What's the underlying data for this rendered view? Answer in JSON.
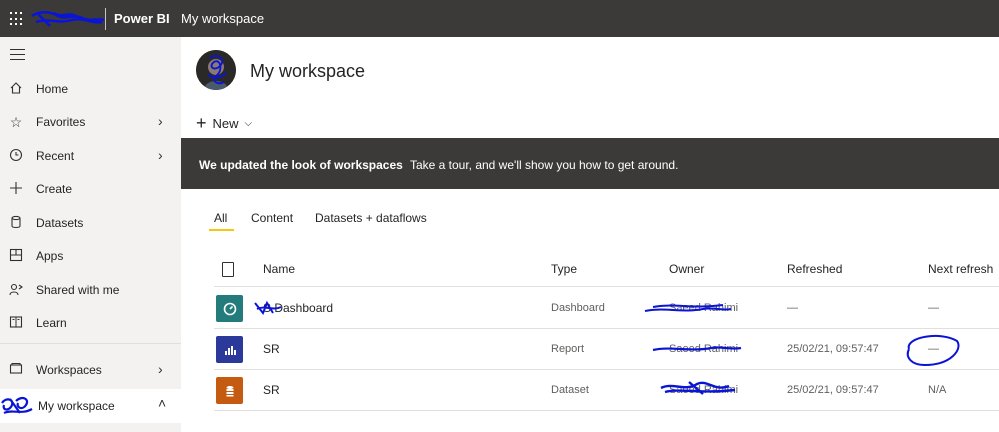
{
  "topbar": {
    "app_name": "Power BI",
    "breadcrumb": "My workspace"
  },
  "sidebar": {
    "items": [
      {
        "label": "Home",
        "icon": "home-icon"
      },
      {
        "label": "Favorites",
        "icon": "star-icon",
        "has_chevron": true
      },
      {
        "label": "Recent",
        "icon": "clock-icon",
        "has_chevron": true
      },
      {
        "label": "Create",
        "icon": "plus-icon"
      },
      {
        "label": "Datasets",
        "icon": "cylinder-icon"
      },
      {
        "label": "Apps",
        "icon": "apps-icon"
      },
      {
        "label": "Shared with me",
        "icon": "share-person-icon"
      },
      {
        "label": "Learn",
        "icon": "book-icon"
      },
      {
        "label": "Workspaces",
        "icon": "workspaces-icon",
        "has_chevron": true
      },
      {
        "label": "My workspace",
        "icon": "avatar-icon",
        "expanded": true
      }
    ]
  },
  "main": {
    "title": "My workspace",
    "new_label": "New",
    "banner": {
      "bold": "We updated the look of workspaces",
      "text": "Take a tour, and we'll show you how to get around."
    },
    "tabs": [
      {
        "label": "All",
        "active": true
      },
      {
        "label": "Content"
      },
      {
        "label": "Datasets + dataflows"
      }
    ],
    "columns": [
      "Name",
      "Type",
      "Owner",
      "Refreshed",
      "Next refresh"
    ],
    "rows": [
      {
        "name": "S Dashboard",
        "type": "Dashboard",
        "owner": "Saeed Rahimi",
        "refreshed": "—",
        "next": "—",
        "icon": "dashboard-icon",
        "color": "#237b7b"
      },
      {
        "name": "SR",
        "type": "Report",
        "owner": "Saeed Rahimi",
        "refreshed": "25/02/21, 09:57:47",
        "next": "—",
        "icon": "report-icon",
        "color": "#2b3a9a"
      },
      {
        "name": "SR",
        "type": "Dataset",
        "owner": "Saeed Rahimi",
        "refreshed": "25/02/21, 09:57:47",
        "next": "N/A",
        "icon": "dataset-icon",
        "color": "#c55a11"
      }
    ]
  },
  "colors": {
    "topbar": "#3b3a39",
    "sidebar": "#f3f2f1",
    "accent_tab": "#f2c811",
    "scribble": "#0a14d6"
  }
}
